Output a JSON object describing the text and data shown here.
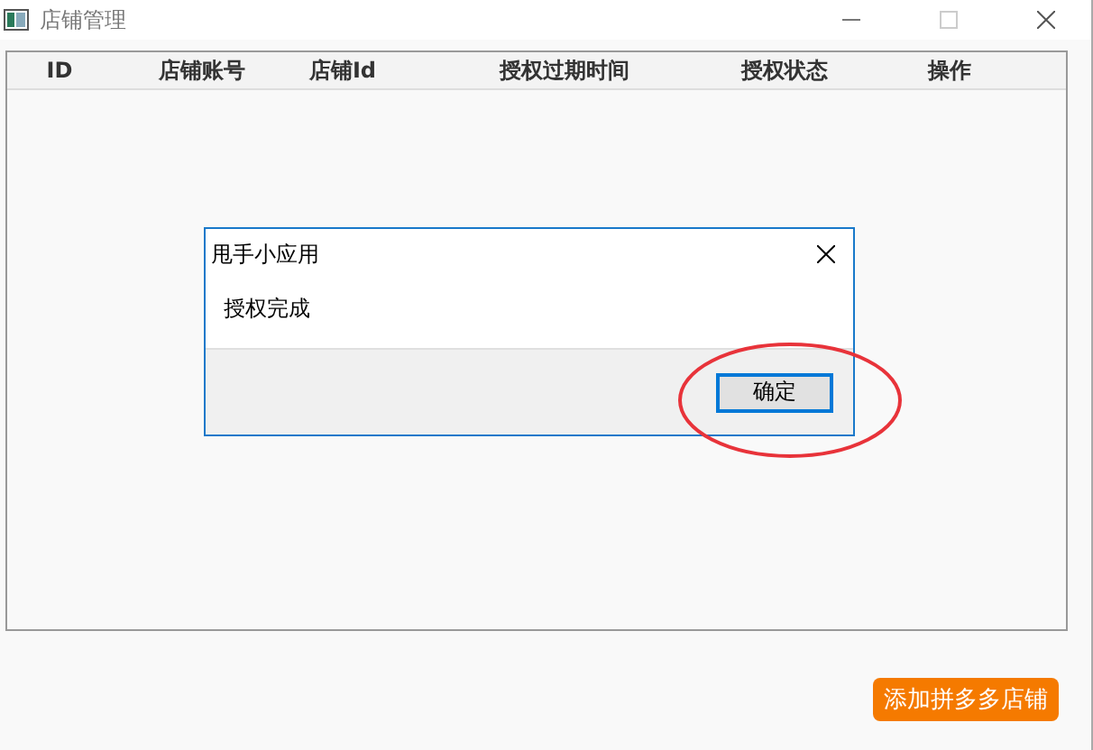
{
  "window": {
    "title": "店铺管理"
  },
  "table": {
    "columns": [
      "ID",
      "店铺账号",
      "店铺Id",
      "授权过期时间",
      "授权状态",
      "操作"
    ]
  },
  "dialog": {
    "title": "甩手小应用",
    "message": "授权完成",
    "button": "确定",
    "highlighted": true
  },
  "add_button": "添加拼多多店铺"
}
